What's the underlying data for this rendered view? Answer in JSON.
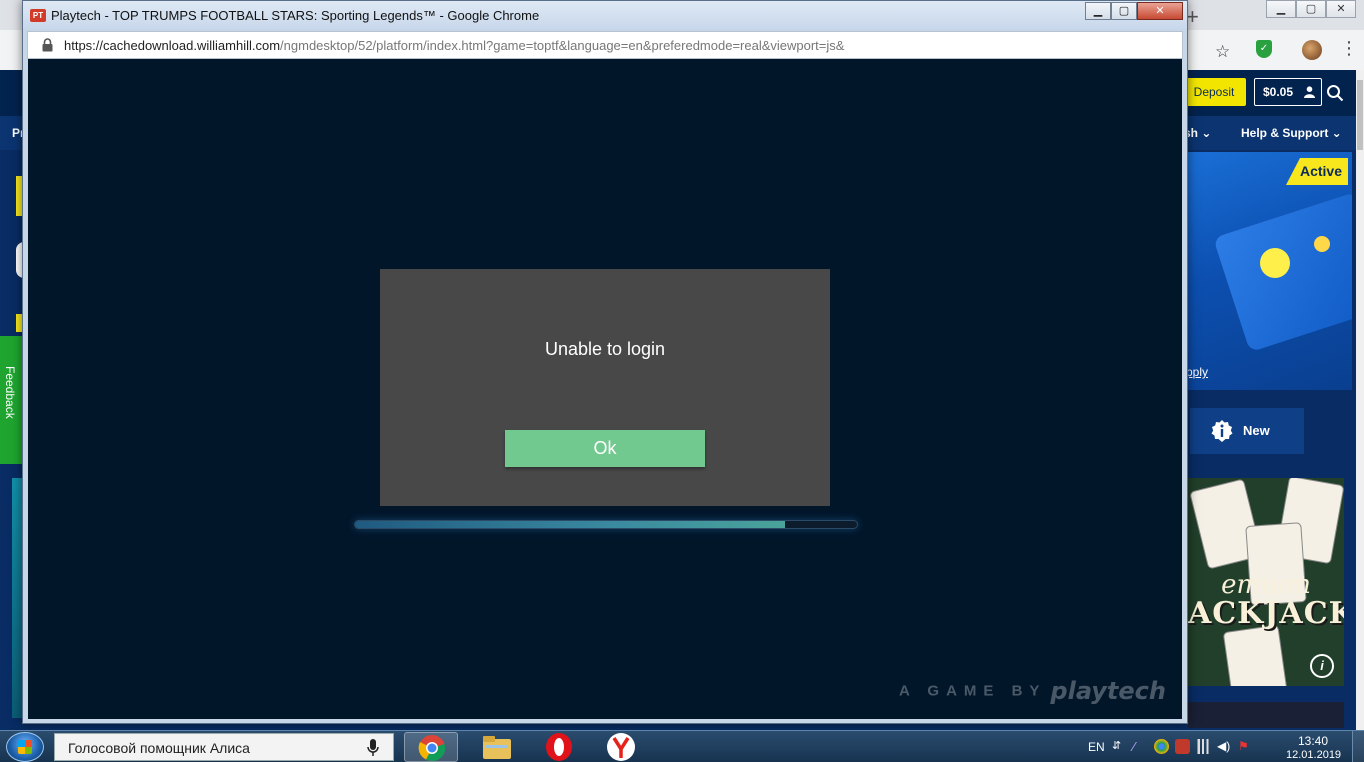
{
  "popup": {
    "title": "Playtech - TOP TRUMPS FOOTBALL STARS: Sporting Legends™ - Google Chrome",
    "favicon_label": "PT",
    "url_host": "https://cachedownload.williamhill.com",
    "url_path": "/ngmdesktop/52/platform/index.html?game=toptf&language=en&preferedmode=real&viewport=js&",
    "controls": {
      "minimize": "▁",
      "maximize": "▢",
      "close": "✕"
    }
  },
  "game": {
    "dialog_message": "Unable to login",
    "ok_label": "Ok",
    "loading_progress": 0.856,
    "brand_prefix": "A GAME BY",
    "brand_logo": "playtech"
  },
  "background_site": {
    "deposit_label": "Deposit",
    "balance": "$0.05",
    "nav_partial_left": "Pr",
    "nav_partial_right": "sh",
    "nav_help": "Help & Support",
    "active_badge": "Active",
    "apply_link": "pply",
    "new_label": "New",
    "blackjack_sub": "emium",
    "blackjack_title": "ACKJACK",
    "feedback_label": "Feedback",
    "new_tab_glyph": "+"
  },
  "taskbar": {
    "search_text": "Голосовой помощник Алиса",
    "language": "EN",
    "time": "13:40",
    "date": "12.01.2019",
    "apps": [
      "chrome",
      "file-explorer",
      "opera",
      "yandex-browser"
    ]
  },
  "colors": {
    "game_bg": "#02162a",
    "dialog_bg": "#484848",
    "ok_button": "#72c98f",
    "deposit": "#f2e600",
    "feedback": "#1fa52f"
  }
}
